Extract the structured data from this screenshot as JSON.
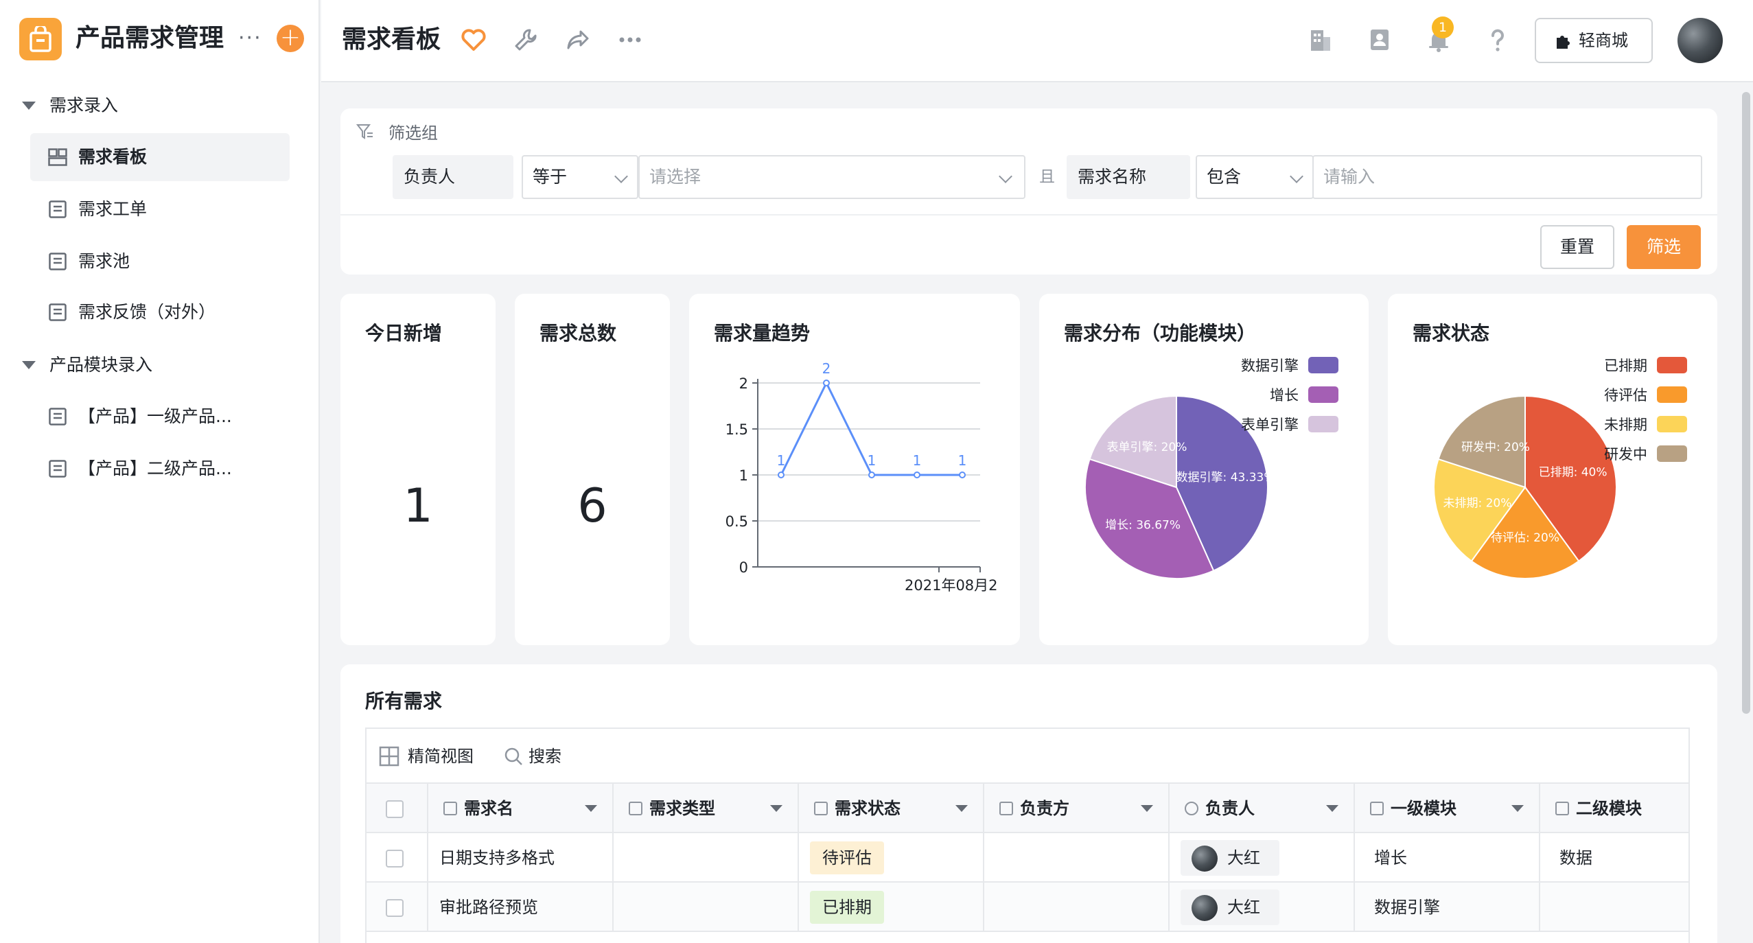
{
  "app": {
    "title": "产品需求管理",
    "more": "···",
    "add": "+"
  },
  "sidebar": {
    "groups": [
      {
        "label": "需求录入",
        "items": [
          {
            "label": "需求看板",
            "active": true,
            "icon": "dashboard-icon"
          },
          {
            "label": "需求工单",
            "icon": "form-icon"
          },
          {
            "label": "需求池",
            "icon": "form-icon"
          },
          {
            "label": "需求反馈（对外）",
            "icon": "form-icon"
          }
        ]
      },
      {
        "label": "产品模块录入",
        "items": [
          {
            "label": "【产品】一级产品...",
            "icon": "form-icon"
          },
          {
            "label": "【产品】二级产品...",
            "icon": "form-icon"
          }
        ]
      }
    ]
  },
  "topbar": {
    "title": "需求看板",
    "notification_count": "1",
    "shop_label": "轻商城",
    "icons": [
      "heart-icon",
      "wrench-icon",
      "share-icon",
      "more-icon",
      "building-icon",
      "contacts-icon",
      "bell-icon",
      "help-icon"
    ]
  },
  "filter": {
    "title": "筛选组",
    "cond1": {
      "field": "负责人",
      "op": "等于",
      "placeholder": "请选择"
    },
    "joiner": "且",
    "cond2": {
      "field": "需求名称",
      "op": "包含",
      "placeholder": "请输入"
    },
    "reset_label": "重置",
    "filter_label": "筛选"
  },
  "stats": {
    "today_new": {
      "title": "今日新增",
      "value": "1"
    },
    "total": {
      "title": "需求总数",
      "value": "6"
    }
  },
  "charts": {
    "trend_title": "需求量趋势",
    "module_title": "需求分布（功能模块）",
    "status_title": "需求状态"
  },
  "chart_data": [
    {
      "type": "line",
      "title": "需求量趋势",
      "x_tick_label": "2021年08月2",
      "values": [
        1,
        2,
        1,
        1,
        1
      ],
      "ylim": [
        0,
        2
      ],
      "y_ticks": [
        "0",
        "0.5",
        "1",
        "1.5",
        "2"
      ],
      "color": "#5b8ff9",
      "grid": true
    },
    {
      "type": "pie",
      "title": "需求分布（功能模块）",
      "legend_position": "top-right",
      "slices": [
        {
          "name": "数据引擎",
          "value": 43.33,
          "label": "数据引擎: 43.33%",
          "color": "#7262b7"
        },
        {
          "name": "增长",
          "value": 36.67,
          "label": "增长: 36.67%",
          "color": "#a45fb4"
        },
        {
          "name": "表单引擎",
          "value": 20,
          "label": "表单引擎: 20%",
          "color": "#d6c4dd"
        }
      ]
    },
    {
      "type": "pie",
      "title": "需求状态",
      "legend_position": "top-right",
      "slices": [
        {
          "name": "已排期",
          "value": 40,
          "label": "已排期: 40%",
          "color": "#e4583a"
        },
        {
          "name": "待评估",
          "value": 20,
          "label": "待评估: 20%",
          "color": "#f99a2c"
        },
        {
          "name": "未排期",
          "value": 20,
          "label": "未排期: 20%",
          "color": "#fcd458"
        },
        {
          "name": "研发中",
          "value": 20,
          "label": "研发中: 20%",
          "color": "#b8a183"
        }
      ]
    }
  ],
  "table": {
    "title": "所有需求",
    "view_label": "精简视图",
    "search_label": "搜索",
    "columns": [
      "需求名",
      "需求类型",
      "需求状态",
      "负责方",
      "负责人",
      "一级模块",
      "二级模块"
    ],
    "rows": [
      {
        "name": "日期支持多格式",
        "type": "",
        "status": "待评估",
        "status_bg": "#fdf0d4",
        "owner_team": "",
        "owner": "大红",
        "module1": "增长",
        "module2": "数据"
      },
      {
        "name": "审批路径预览",
        "type": "",
        "status": "已排期",
        "status_bg": "#e3f4d6",
        "owner_team": "",
        "owner": "大红",
        "module1": "数据引擎",
        "module2": ""
      }
    ]
  }
}
